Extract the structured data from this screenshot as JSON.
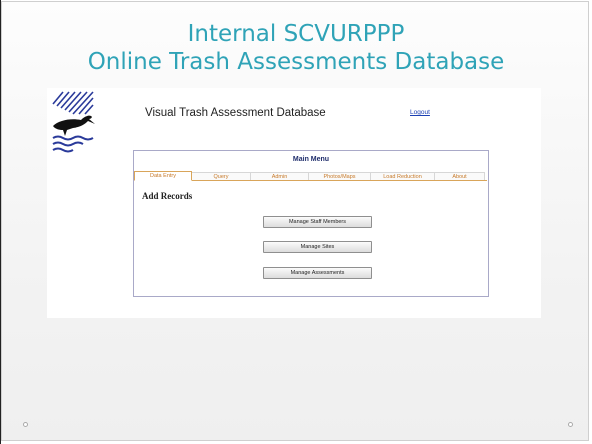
{
  "slide": {
    "title_line1": "Internal SCVURPPP",
    "title_line2": "Online Trash Assessments Database"
  },
  "app": {
    "title": "Visual Trash Assessment Database",
    "logout_label": "Logout"
  },
  "menu": {
    "title": "Main Menu",
    "tabs": [
      {
        "label": "Data Entry",
        "active": true
      },
      {
        "label": "Query",
        "active": false
      },
      {
        "label": "Admin",
        "active": false
      },
      {
        "label": "Photos/Maps",
        "active": false
      },
      {
        "label": "Load Reduction",
        "active": false
      },
      {
        "label": "About",
        "active": false
      }
    ],
    "section_heading": "Add Records",
    "buttons": {
      "staff": "Manage Staff Members",
      "sites": "Manage Sites",
      "assessments": "Manage Assessments"
    }
  },
  "colors": {
    "title_teal": "#2fa3b7",
    "tab_orange": "#c77a2a",
    "menu_title_navy": "#1f2d6b",
    "link_blue": "#1a3fb3"
  },
  "icons": {
    "logo": "bird-on-water-logo"
  }
}
